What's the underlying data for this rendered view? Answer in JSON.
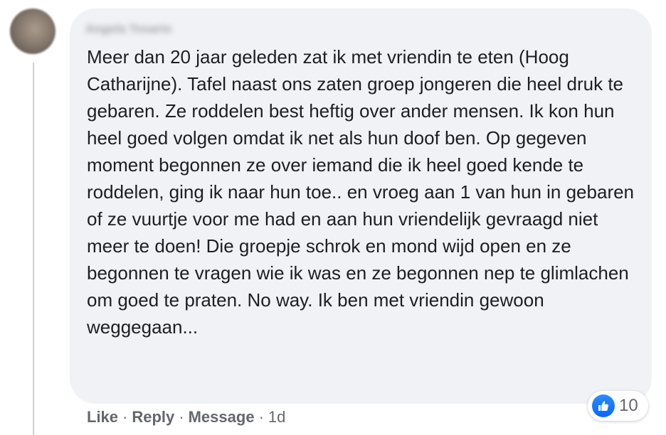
{
  "comment": {
    "author": "Angela Tosario",
    "text": "Meer dan 20 jaar geleden zat ik met vriendin te eten (Hoog Catharijne). Tafel naast ons zaten groep jongeren die heel druk te gebaren. Ze roddelen best heftig over ander mensen. Ik kon hun heel goed volgen omdat ik net als hun doof ben. Op gegeven moment begonnen ze over iemand die ik heel goed kende te roddelen, ging ik naar hun toe.. en vroeg aan 1 van hun in gebaren of ze vuurtje voor me had en aan hun vriendelijk gevraagd niet meer te doen! Die groepje schrok en mond wijd open en ze begonnen te vragen wie ik was en ze begonnen nep te glimlachen om goed te praten. No way. Ik ben met vriendin gewoon weggegaan...",
    "reaction_icon": "like-thumbs-up-icon",
    "reaction_count": "10"
  },
  "actions": {
    "like": "Like",
    "reply": "Reply",
    "message": "Message",
    "separator": "·",
    "timestamp": "1d"
  },
  "colors": {
    "bubble": "#f0f2f5",
    "text": "#1c1e21",
    "secondary": "#65676b",
    "like_blue": "#0866ff"
  }
}
